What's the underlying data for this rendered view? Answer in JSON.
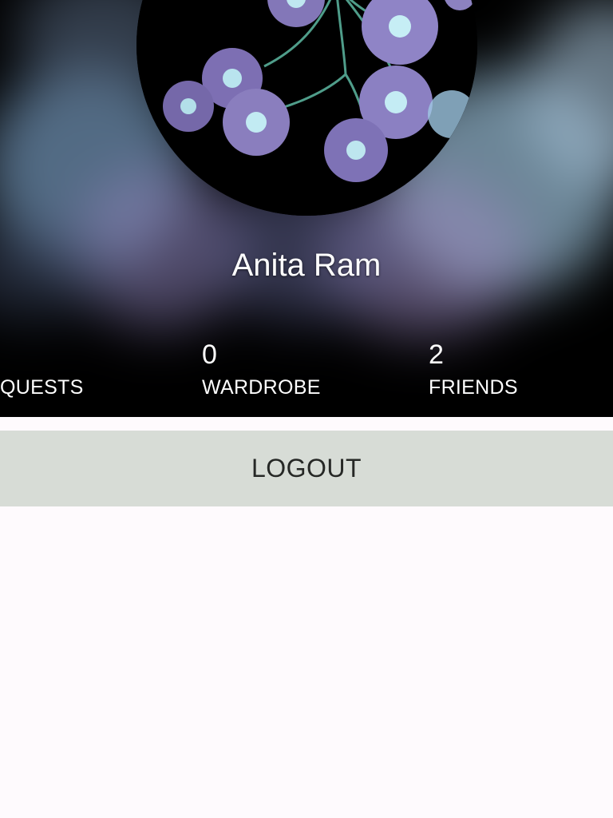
{
  "profile": {
    "name": "Anita Ram",
    "avatar_icon": "flower-photo"
  },
  "stats": {
    "quests": {
      "value": "",
      "label": "QUESTS"
    },
    "wardrobe": {
      "value": "0",
      "label": "WARDROBE"
    },
    "friends": {
      "value": "2",
      "label": "FRIENDS"
    }
  },
  "actions": {
    "logout_label": "LOGOUT"
  },
  "colors": {
    "header_bg": "#000000",
    "logout_bg": "#d7dcd6",
    "page_bg": "#fefafd",
    "text_on_header": "#ffffff"
  }
}
